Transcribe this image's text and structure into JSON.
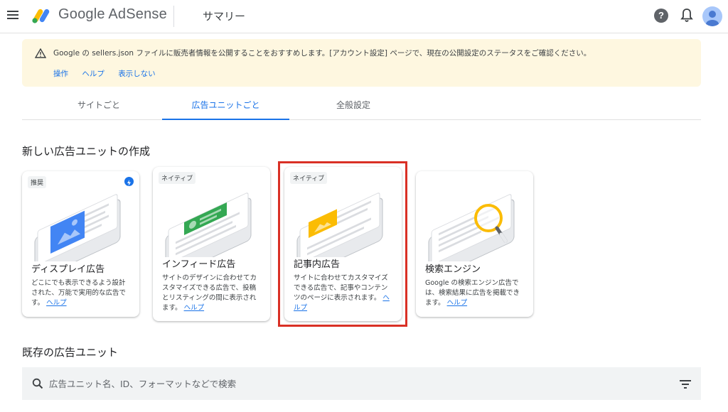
{
  "header": {
    "logo_text": "Google AdSense",
    "page_title": "サマリー"
  },
  "banner": {
    "message": "Google の sellers.json ファイルに販売者情報を公開することをおすすめします。[アカウント設定] ページで、現在の公開設定のステータスをご確認ください。",
    "links": [
      "操作",
      "ヘルプ",
      "表示しない"
    ]
  },
  "tabs": [
    "サイトごと",
    "広告ユニットごと",
    "全般設定"
  ],
  "active_tab": "広告ユニットごと",
  "new_section_title": "新しい広告ユニットの作成",
  "cards": [
    {
      "badge": "推奨",
      "title": "ディスプレイ広告",
      "description": "どこにでも表示できるよう設計された、万能で実用的な広告です。",
      "help": "ヘルプ",
      "illustration": "display-ad-illustration"
    },
    {
      "badge": "ネイティブ",
      "title": "インフィード広告",
      "description": "サイトのデザインに合わせてカスタマイズできる広告で、投稿とリスティングの間に表示されます。",
      "help": "ヘルプ",
      "illustration": "infeed-ad-illustration"
    },
    {
      "badge": "ネイティブ",
      "title": "記事内広告",
      "description": "サイトに合わせてカスタマイズできる広告で、記事やコンテンツのページに表示されます。",
      "help": "ヘルプ",
      "illustration": "inarticle-ad-illustration",
      "highlighted": true
    },
    {
      "badge": "",
      "title": "検索エンジン",
      "description": "Google の検索エンジン広告では、検索結果に広告を掲載できます。",
      "help": "ヘルプ",
      "illustration": "search-engine-illustration"
    }
  ],
  "existing_section_title": "既存の広告ユニット",
  "search": {
    "placeholder": "広告ユニット名、ID、フォーマットなどで検索"
  },
  "colors": {
    "accent": "#1a73e8",
    "banner_bg": "#fef7e0",
    "highlight_border": "#d93025"
  },
  "icons": [
    "menu-icon",
    "adsense-logo-icon",
    "help-icon",
    "bell-icon",
    "avatar-icon",
    "warning-icon",
    "bolt-icon",
    "search-icon",
    "filter-icon"
  ]
}
